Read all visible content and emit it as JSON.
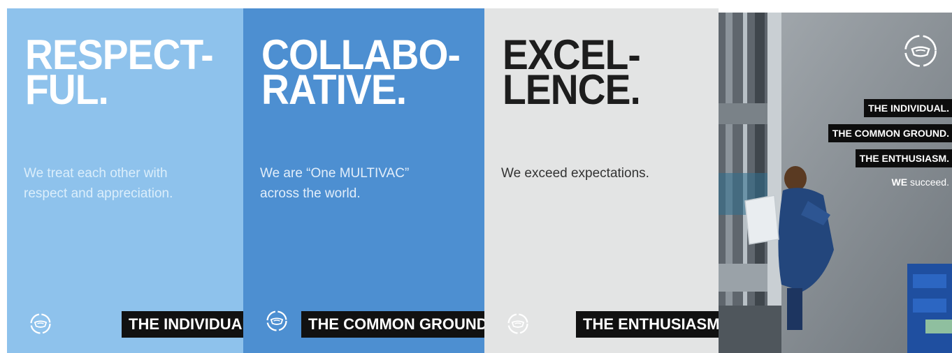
{
  "panels": [
    {
      "headline": [
        "RESPECT-",
        "FUL."
      ],
      "subline": [
        "We treat each other with",
        "respect and appreciation."
      ],
      "tag": "THE INDIVIDUAL."
    },
    {
      "headline": [
        "COLLABO-",
        "RATIVE."
      ],
      "subline": [
        "We are “One MULTIVAC”",
        "across the world."
      ],
      "tag": "THE COMMON GROUND."
    },
    {
      "headline": [
        "EXCEL-",
        "LENCE."
      ],
      "subline": [
        "We exceed expectations."
      ],
      "tag": "THE ENTHUSIASM."
    }
  ],
  "photo_panel": {
    "stack": [
      "THE INDIVIDUAL.",
      "THE COMMON GROUND.",
      "THE ENTHUSIASM."
    ],
    "closing_we": "WE",
    "closing_rest": " succeed."
  },
  "colors": {
    "light_blue": "#8ec2ec",
    "mid_blue": "#4d8fd1",
    "light_grey": "#e3e4e4",
    "tag_black": "#111111"
  },
  "icons": [
    "multivac-logo-icon"
  ]
}
